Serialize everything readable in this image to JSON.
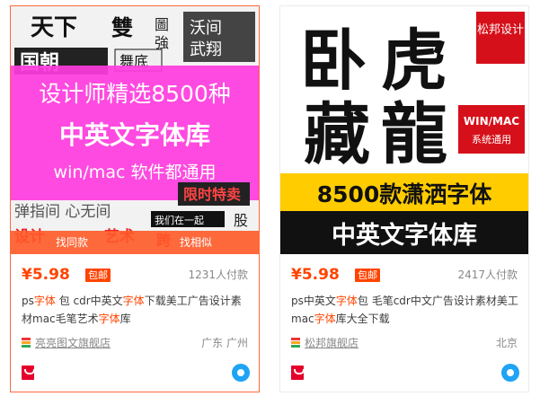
{
  "cards": [
    {
      "price": "¥5.98",
      "badge": "包邮",
      "sold": "1231人付款",
      "title_parts": [
        "ps",
        "字体",
        " 包 cdr中英文",
        "字体",
        "下载美工广告设计素材mac毛笔艺术",
        "字体",
        "库"
      ],
      "shop": "亮亮图文旗舰店",
      "location": "广东 广州",
      "overlay": {
        "left": "找同款",
        "right": "找相似"
      },
      "image_text": {
        "line1": "设计师精选8500种",
        "line2": "中英文字体库",
        "line3": "win/mac 软件都通用",
        "bg_words": [
          "天下",
          "雙",
          "圖",
          "強",
          "沃间",
          "武翔",
          "国朝",
          "舞底",
          "弹指间 心无间",
          "设计",
          "艺术",
          "限时特卖",
          "我们在一起",
          "股",
          "跨"
        ]
      }
    },
    {
      "price": "¥5.98",
      "badge": "包邮",
      "sold": "2417人付款",
      "title_parts": [
        "ps中英文",
        "字体",
        "包 毛笔cdr中文广告设计素材美工mac",
        "字体",
        "库大全下载"
      ],
      "shop": "松邦旗舰店",
      "location": "北京",
      "image_text": {
        "big_chars": [
          "卧",
          "虎",
          "藏",
          "龍"
        ],
        "seal": "松邦设计",
        "platform": "WIN/MAC",
        "platform_sub": "系统通用",
        "banner1": "8500款潇洒字体",
        "banner2": "中英文字体库"
      }
    }
  ]
}
